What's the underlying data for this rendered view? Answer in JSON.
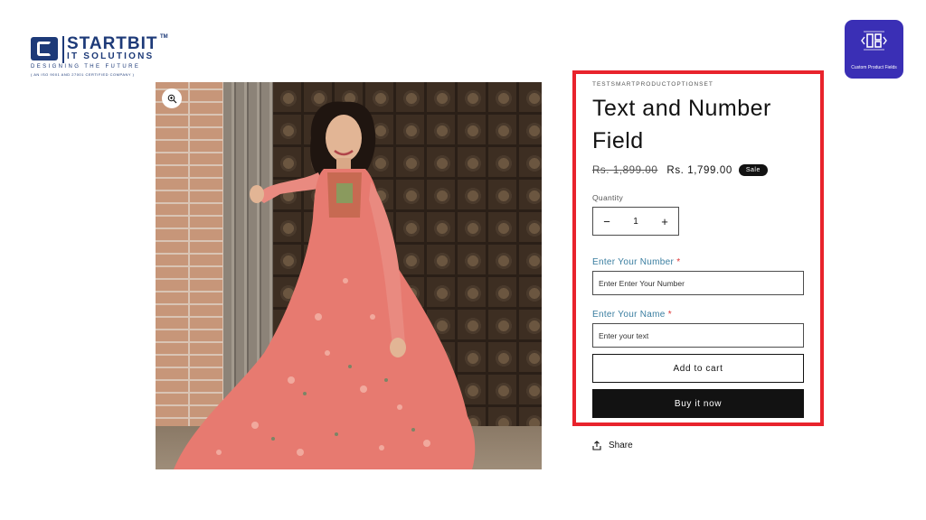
{
  "logo": {
    "name": "STARTBIT",
    "tm": "TM",
    "sub": "IT SOLUTIONS",
    "tagline": "DESIGNING THE FUTURE",
    "certification": "( AN ISO 9001 AND 27001 CERTIFIED COMPANY )"
  },
  "app_badge": {
    "label": "Custom Product Fields",
    "icon": "grid-brackets-icon",
    "color": "#3a2fb5"
  },
  "media": {
    "zoom_icon": "zoom-in-icon"
  },
  "product": {
    "vendor": "TESTSMARTPRODUCTOPTIONSET",
    "title": "Text and Number Field",
    "price_compare": "Rs. 1,899.00",
    "price_sale": "Rs. 1,799.00",
    "sale_badge": "Sale",
    "quantity_label": "Quantity",
    "quantity_value": "1",
    "decrease_symbol": "−",
    "increase_symbol": "+",
    "number_field": {
      "label": "Enter Your Number",
      "required_mark": "*",
      "placeholder": "Enter Enter Your Number"
    },
    "name_field": {
      "label": "Enter Your Name",
      "required_mark": "*",
      "placeholder": "Enter your text"
    },
    "add_to_cart": "Add to cart",
    "buy_now": "Buy it now",
    "share": "Share",
    "share_icon": "share-upload-icon"
  },
  "colors": {
    "highlight_border": "#e8232c",
    "field_label": "#3a7ea0",
    "button_dark": "#121212"
  }
}
